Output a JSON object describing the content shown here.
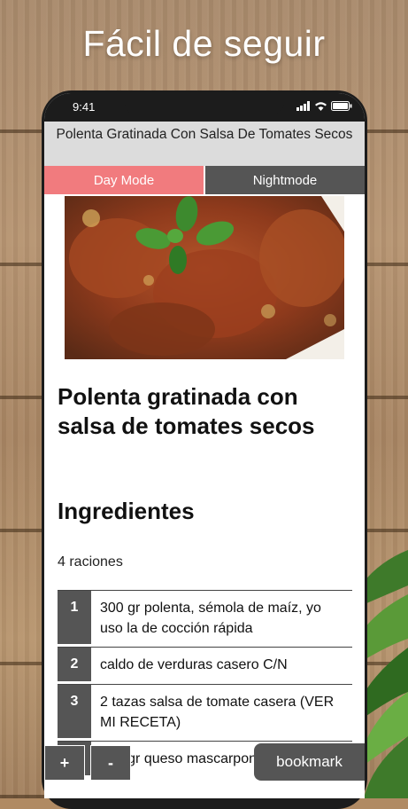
{
  "headline": "Fácil de seguir",
  "status_bar": {
    "time": "9:41",
    "icons": [
      "signal-icon",
      "wifi-icon",
      "battery-icon"
    ]
  },
  "title_bar": {
    "title": "Polenta Gratinada Con Salsa De Tomates Secos"
  },
  "mode_toggle": {
    "day_label": "Day Mode",
    "night_label": "Nightmode",
    "active": "day"
  },
  "recipe": {
    "title": "Polenta gratinada con salsa de tomates secos",
    "ingredients_heading": "Ingredientes",
    "servings": "4 raciones",
    "ingredients": [
      {
        "num": "1",
        "text": "300 gr polenta, sémola de maíz, yo uso la de cocción rápida"
      },
      {
        "num": "2",
        "text": "caldo de verduras casero C/N"
      },
      {
        "num": "3",
        "text": "2 tazas salsa de tomate casera (VER MI RECETA)"
      },
      {
        "num": "4",
        "text": "200 gr queso mascarpone"
      }
    ]
  },
  "controls": {
    "zoom_in": "+",
    "zoom_out": "-",
    "bookmark": "bookmark"
  },
  "colors": {
    "day_mode": "#f17b7e",
    "night_mode": "#555555",
    "title_bar": "#dcdcdc"
  }
}
